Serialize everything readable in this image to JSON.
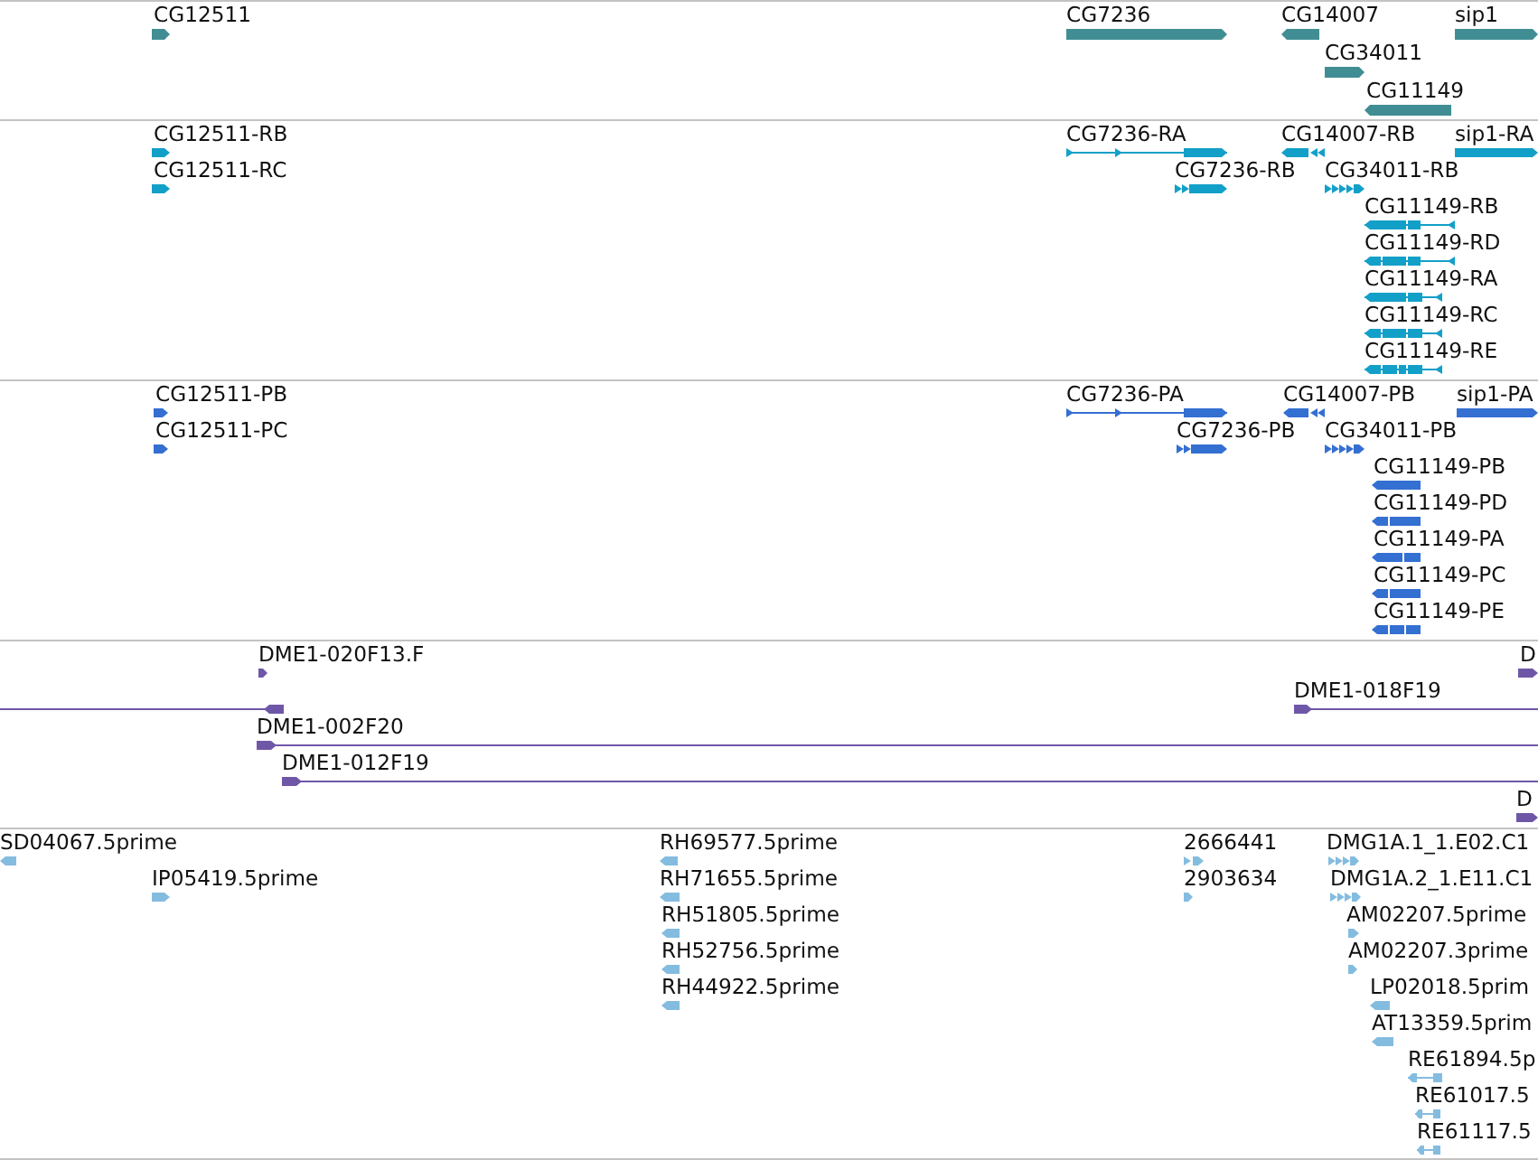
{
  "tracks": [
    {
      "kind": "gene",
      "color": "#408e94",
      "features": [
        {
          "label": "CG12511",
          "reverse": false
        },
        {
          "label": "CG7236",
          "reverse": false
        },
        {
          "label": "CG14007",
          "reverse": true
        },
        {
          "label": "CG34011",
          "reverse": false
        },
        {
          "label": "CG11149",
          "reverse": true
        },
        {
          "label": "sip1",
          "reverse": false
        }
      ]
    },
    {
      "kind": "transcript",
      "color": "#12a0c8",
      "features": [
        {
          "label": "CG12511-RB",
          "reverse": false
        },
        {
          "label": "CG12511-RC",
          "reverse": false
        },
        {
          "label": "CG7236-RA",
          "reverse": false
        },
        {
          "label": "CG7236-RB",
          "reverse": false
        },
        {
          "label": "CG14007-RB",
          "reverse": true
        },
        {
          "label": "CG34011-RB",
          "reverse": false
        },
        {
          "label": "sip1-RA",
          "reverse": false
        },
        {
          "label": "CG11149-RB",
          "reverse": true
        },
        {
          "label": "CG11149-RD",
          "reverse": true
        },
        {
          "label": "CG11149-RA",
          "reverse": true
        },
        {
          "label": "CG11149-RC",
          "reverse": true
        },
        {
          "label": "CG11149-RE",
          "reverse": true
        }
      ]
    },
    {
      "kind": "protein",
      "color": "#346fd2",
      "features": [
        {
          "label": "CG12511-PB",
          "reverse": false
        },
        {
          "label": "CG12511-PC",
          "reverse": false
        },
        {
          "label": "CG7236-PA",
          "reverse": false
        },
        {
          "label": "CG7236-PB",
          "reverse": false
        },
        {
          "label": "CG14007-PB",
          "reverse": true
        },
        {
          "label": "CG34011-PB",
          "reverse": false
        },
        {
          "label": "sip1-PA",
          "reverse": false
        },
        {
          "label": "CG11149-PB",
          "reverse": true
        },
        {
          "label": "CG11149-PD",
          "reverse": true
        },
        {
          "label": "CG11149-PA",
          "reverse": true
        },
        {
          "label": "CG11149-PC",
          "reverse": true
        },
        {
          "label": "CG11149-PE",
          "reverse": true
        }
      ]
    },
    {
      "kind": "clone",
      "color": "#6f57a8",
      "features": [
        {
          "label": "DME1-020F13.F",
          "reverse": false
        },
        {
          "label": "D",
          "reverse": false
        },
        {
          "reverse": true
        },
        {
          "label": "DME1-018F19",
          "reverse": false
        },
        {
          "label": "DME1-002F20",
          "reverse": false
        },
        {
          "label": "DME1-012F19",
          "reverse": false
        },
        {
          "label": "D",
          "reverse": false
        }
      ]
    },
    {
      "kind": "est",
      "color": "#84bce0",
      "features": [
        {
          "label": "SD04067.5prime",
          "reverse": true
        },
        {
          "label": "IP05419.5prime",
          "reverse": false
        },
        {
          "label": "RH69577.5prime",
          "reverse": true
        },
        {
          "label": "RH71655.5prime",
          "reverse": true
        },
        {
          "label": "RH51805.5prime",
          "reverse": true
        },
        {
          "label": "RH52756.5prime",
          "reverse": true
        },
        {
          "label": "RH44922.5prime",
          "reverse": true
        },
        {
          "label": "2666441",
          "reverse": false
        },
        {
          "label": "2903634",
          "reverse": false
        },
        {
          "label": "DMG1A.1_1.E02.C1",
          "reverse": false
        },
        {
          "label": "DMG1A.2_1.E11.C1",
          "reverse": false
        },
        {
          "label": "AM02207.5prime",
          "reverse": false
        },
        {
          "label": "AM02207.3prime",
          "reverse": false
        },
        {
          "label": "LP02018.5prim",
          "reverse": true
        },
        {
          "label": "AT13359.5prim",
          "reverse": true
        },
        {
          "label": "RE61894.5p",
          "reverse": true
        },
        {
          "label": "RE61017.5",
          "reverse": true
        },
        {
          "label": "RE61117.5",
          "reverse": true
        }
      ]
    }
  ]
}
